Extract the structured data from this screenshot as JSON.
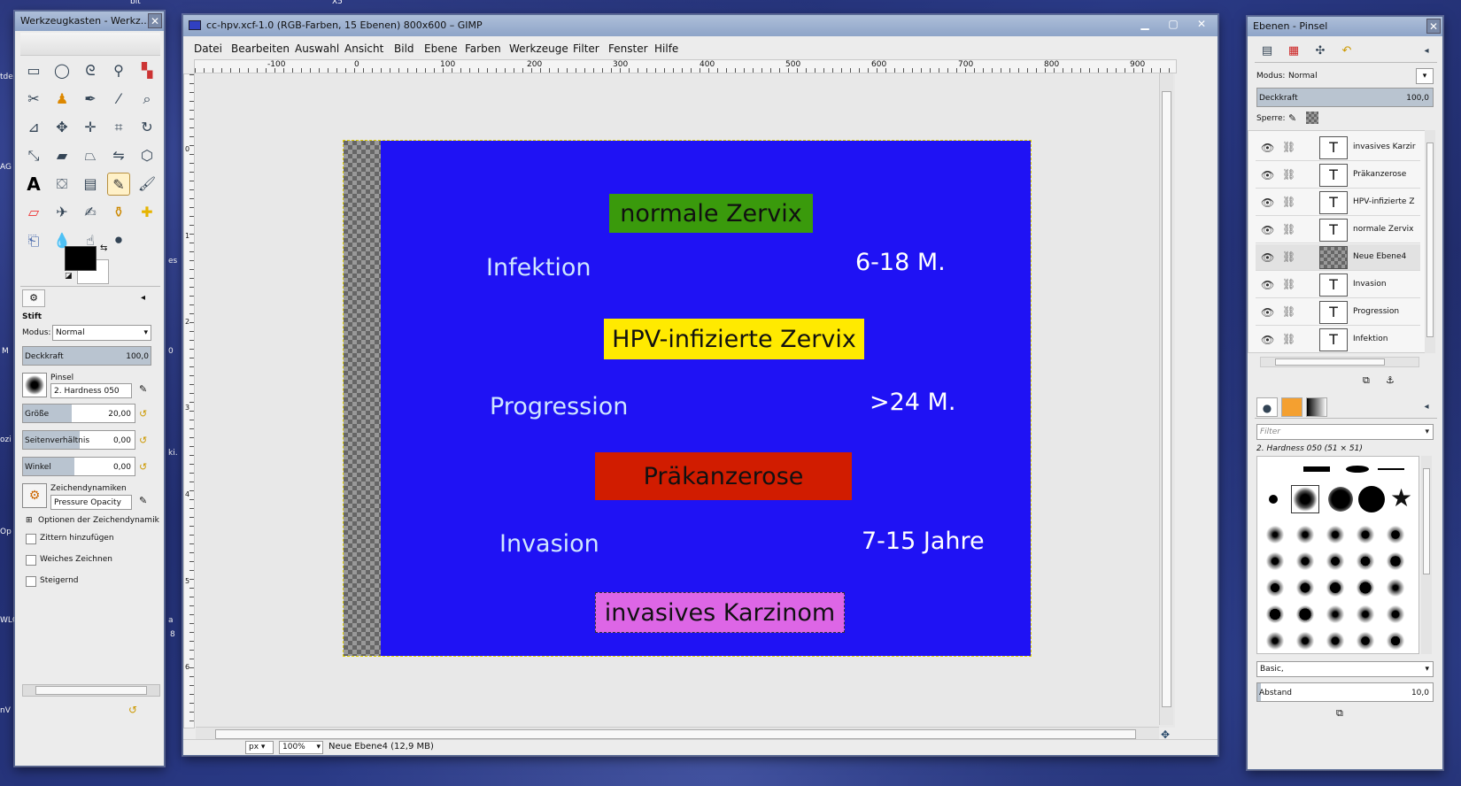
{
  "desktop": {
    "fragments": [
      "bit",
      "X5",
      "tde",
      "AG",
      "es",
      "M",
      "0",
      "ki.",
      "Op",
      "ozi",
      "WLC",
      "nV",
      "a",
      "8"
    ]
  },
  "toolbox": {
    "title": "Werkzeugkasten - Werkz...",
    "close": "✕",
    "tool_name": "Stift",
    "modus_label": "Modus:",
    "modus_value": "Normal",
    "deckkraft_label": "Deckkraft",
    "deckkraft_value": "100,0",
    "deckkraft_level": 1.0,
    "pinsel_label": "Pinsel",
    "pinsel_value": "2. Hardness 050",
    "groesse_label": "Größe",
    "groesse_value": "20,00",
    "seiten_label": "Seitenverhältnis",
    "seiten_value": "0,00",
    "winkel_label": "Winkel",
    "winkel_value": "0,00",
    "dyn_label": "Zeichendynamiken",
    "dyn_value": "Pressure Opacity",
    "opt_dyn": "Optionen der Zeichendynamik",
    "zittern": "Zittern hinzufügen",
    "weiches": "Weiches Zeichnen",
    "steigernd": "Steigernd",
    "fg_color": "#000000",
    "bg_color": "#ffffff"
  },
  "main": {
    "title": "cc-hpv.xcf-1.0 (RGB-Farben, 15 Ebenen) 800x600 – GIMP",
    "menu": [
      "Datei",
      "Bearbeiten",
      "Auswahl",
      "Ansicht",
      "Bild",
      "Ebene",
      "Farben",
      "Werkzeuge",
      "Filter",
      "Fenster",
      "Hilfe"
    ],
    "ruler_ticks": [
      "-100",
      "0",
      "100",
      "200",
      "300",
      "400",
      "500",
      "600",
      "700",
      "800",
      "900"
    ],
    "vruler_ticks": [
      "0",
      "1",
      "2",
      "3",
      "4",
      "5",
      "6"
    ],
    "unit": "px",
    "zoom": "100%",
    "status": "Neue Ebene4 (12,9 MB)",
    "canvas": {
      "bg": "#1f12f4",
      "boxes": [
        {
          "text": "normale Zervix",
          "color": "#3a9a0c"
        },
        {
          "text": "HPV-infizierte Zervix",
          "color": "#ffea00"
        },
        {
          "text": "Präkanzerose",
          "color": "#d11c00"
        },
        {
          "text": "invasives Karzinom",
          "color": "#dd66e6"
        }
      ],
      "left_labels": [
        "Infektion",
        "Progression",
        "Invasion"
      ],
      "right_labels": [
        "6-18 M.",
        ">24 M.",
        "7-15 Jahre"
      ]
    }
  },
  "layers": {
    "title": "Ebenen - Pinsel",
    "modus_label": "Modus:",
    "modus_value": "Normal",
    "deckkraft_label": "Deckkraft",
    "deckkraft_value": "100,0",
    "sperre_label": "Sperre:",
    "items": [
      "invasives Karzir",
      "Präkanzerose",
      "HPV-infizierte Z",
      "normale Zervix",
      "Neue Ebene4",
      "Invasion",
      "Progression",
      "Infektion"
    ],
    "filter_placeholder": "Filter",
    "brush_name": "2. Hardness 050 (51 × 51)",
    "brush_set": "Basic,",
    "abstand_label": "Abstand",
    "abstand_value": "10,0"
  }
}
